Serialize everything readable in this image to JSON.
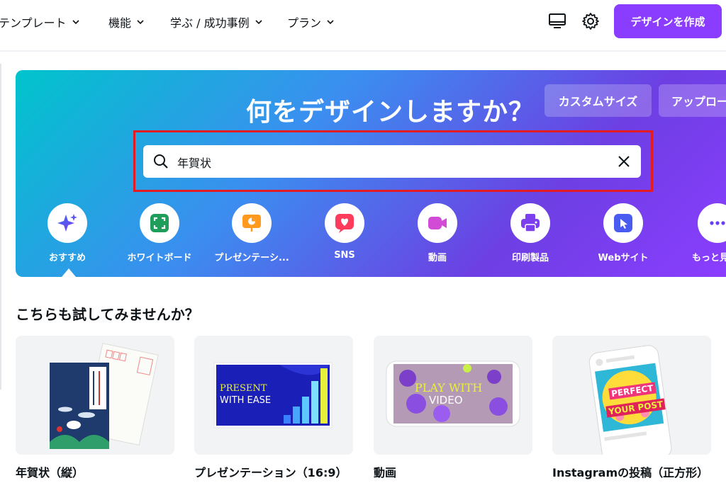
{
  "nav": {
    "items": [
      {
        "label": "テンプレート"
      },
      {
        "label": "機能"
      },
      {
        "label": "学ぶ / 成功事例"
      },
      {
        "label": "プラン"
      }
    ],
    "desktop_icon": "monitor-icon",
    "settings_icon": "gear-icon",
    "create_label": "デザインを作成"
  },
  "colors": {
    "accent": "#8b3dff",
    "highlight": "#e31b23"
  },
  "hero": {
    "title": "何をデザインしますか？",
    "custom_size": "カスタムサイズ",
    "upload": "アップロー",
    "search": {
      "value": "年賀状"
    },
    "categories": [
      {
        "label": "おすすめ",
        "icon": "sparkle-icon"
      },
      {
        "label": "ホワイトボード",
        "icon": "whiteboard-icon"
      },
      {
        "label": "プレゼンテーシ...",
        "icon": "presentation-icon"
      },
      {
        "label": "SNS",
        "icon": "heart-icon"
      },
      {
        "label": "動画",
        "icon": "video-camera-icon"
      },
      {
        "label": "印刷製品",
        "icon": "printer-icon"
      },
      {
        "label": "Webサイト",
        "icon": "cursor-icon"
      },
      {
        "label": "もっと見",
        "icon": "more-icon"
      }
    ]
  },
  "suggestions": {
    "title": "こちらも試してみませんか？",
    "cards": [
      {
        "label": "年賀状（縦）"
      },
      {
        "label": "プレゼンテーション（16:9）",
        "line1": "PRESENT",
        "line2": "WITH EASE"
      },
      {
        "label": "動画",
        "line1": "PLAY WITH",
        "line2": "VIDEO"
      },
      {
        "label": "Instagramの投稿（正方形）",
        "line1": "PERFECT",
        "line2": "YOUR POST"
      }
    ]
  }
}
